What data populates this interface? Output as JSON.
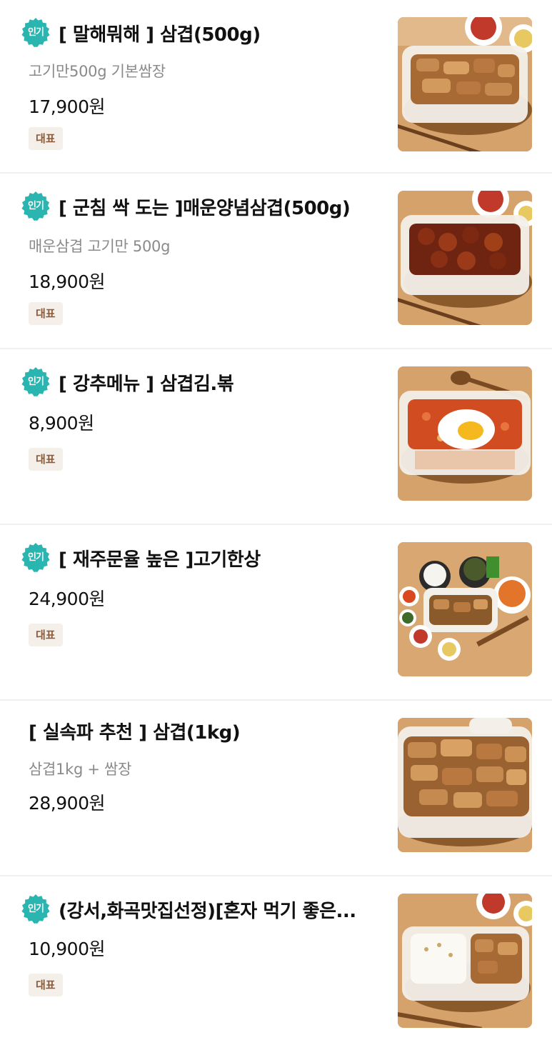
{
  "colors": {
    "badge": "#2ab5b0",
    "tag_bg": "#f4efe9",
    "tag_text": "#8b5a38",
    "desc": "#8a8a8a",
    "divider": "#f0f0f0"
  },
  "menu": {
    "items": [
      {
        "popular": true,
        "badge_label": "인기",
        "title": "[ 말해뭐해 ] 삼겹(500g)",
        "description": "고기만500g 기본쌈장",
        "price": "17,900원",
        "tag": "대표",
        "image_icon": "samgyeop-container-photo"
      },
      {
        "popular": true,
        "badge_label": "인기",
        "title": "[ 군침 싹 도는 ]매운양념삼겹(500g)",
        "description": "매운삼겹 고기만 500g",
        "price": "18,900원",
        "tag": "대표",
        "image_icon": "spicy-samgyeop-container-photo"
      },
      {
        "popular": true,
        "badge_label": "인기",
        "title": "[  강추메뉴 ] 삼겹김.볶",
        "description": "",
        "price": "8,900원",
        "tag": "대표",
        "image_icon": "kimchi-fried-rice-egg-photo"
      },
      {
        "popular": true,
        "badge_label": "인기",
        "title": "[ 재주문율 높은 ]고기한상",
        "description": "",
        "price": "24,900원",
        "tag": "대표",
        "image_icon": "meat-meal-set-photo"
      },
      {
        "popular": false,
        "badge_label": "",
        "title": "[ 실속파 추천 ] 삼겹(1kg)",
        "description": "삼겹1kg + 쌈장",
        "price": "28,900원",
        "tag": "",
        "image_icon": "samgyeop-1kg-container-photo"
      },
      {
        "popular": true,
        "badge_label": "인기",
        "title": "(강서,화곡맛집선정)[혼자 먹기 좋은...",
        "description": "",
        "price": "10,900원",
        "tag": "대표",
        "image_icon": "solo-rice-meat-box-photo"
      }
    ]
  }
}
